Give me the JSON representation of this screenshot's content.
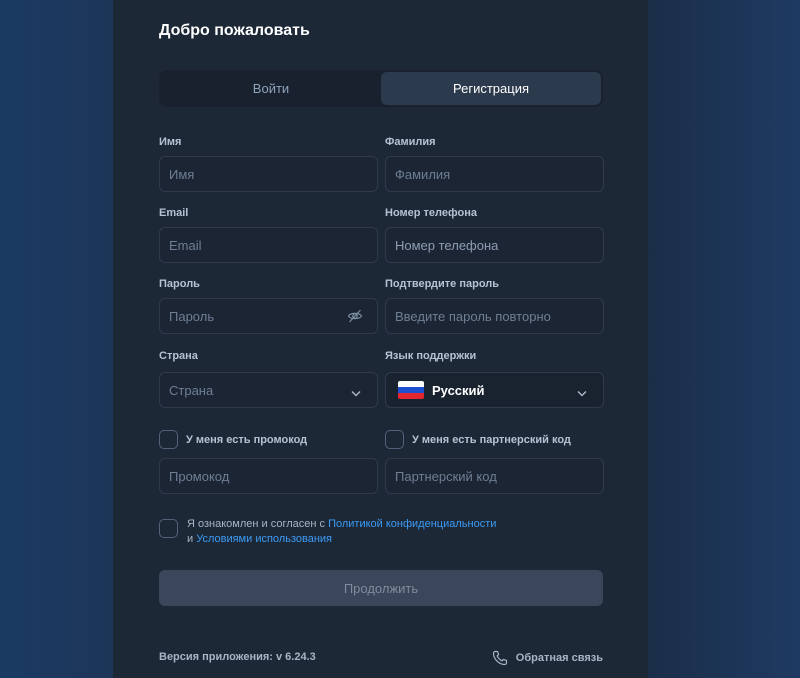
{
  "title": "Добро пожаловать",
  "tabs": [
    {
      "label": "Войти",
      "active": false
    },
    {
      "label": "Регистрация",
      "active": true
    }
  ],
  "form": {
    "first_name": {
      "label": "Имя",
      "placeholder": "Имя"
    },
    "last_name": {
      "label": "Фамилия",
      "placeholder": "Фамилия"
    },
    "email": {
      "label": "Email",
      "placeholder": "Email"
    },
    "phone": {
      "label": "Номер телефона",
      "placeholder": "Номер телефона"
    },
    "password": {
      "label": "Пароль",
      "placeholder": "Пароль"
    },
    "confirm_password": {
      "label": "Подтвердите пароль",
      "placeholder": "Введите пароль повторно"
    },
    "country": {
      "label": "Страна",
      "placeholder": "Страна"
    },
    "support_language": {
      "label": "Язык поддержки",
      "value": "Русский",
      "flag_colors": [
        "#ffffff",
        "#1e4fd1",
        "#e32630"
      ]
    },
    "promo_checkbox": {
      "label": "У меня есть промокод",
      "checked": false
    },
    "promo_code": {
      "placeholder": "Промокод"
    },
    "partner_checkbox": {
      "label": "У меня есть партнерский код",
      "checked": false
    },
    "partner_code": {
      "placeholder": "Партнерский код"
    },
    "agreement": {
      "prefix": "Я ознакомлен и согласен с ",
      "privacy_link": "Политикой конфиденциальности",
      "line2_prefix": "и ",
      "terms_link": "Условиями использования",
      "checked": false
    }
  },
  "continue_label": "Продолжить",
  "footer": {
    "version": "Версия приложения: v 6.24.3",
    "feedback": "Обратная связь"
  },
  "colors": {
    "link": "#3b9bf5",
    "panel": "#1d2837",
    "button_disabled": "#3a4659"
  }
}
